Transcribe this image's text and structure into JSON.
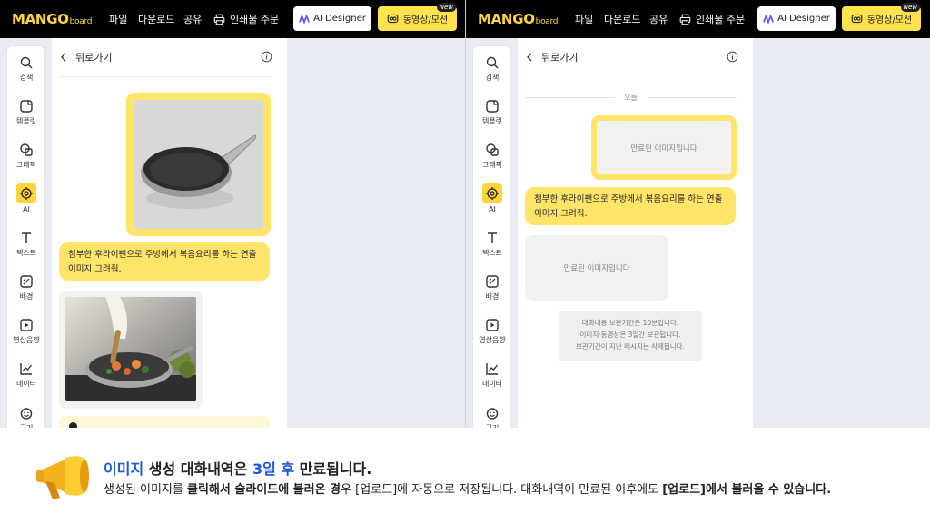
{
  "header": {
    "logo_main": "MANGO",
    "logo_sub": "board",
    "menu": [
      "파일",
      "다운로드",
      "공유",
      "인쇄물 주문"
    ],
    "ai_designer_label": "AI Designer",
    "video_label": "동영상/모션",
    "new_badge": "New"
  },
  "sidebar": {
    "items": [
      {
        "label": "검색",
        "icon": "search-icon"
      },
      {
        "label": "템플릿",
        "icon": "template-icon"
      },
      {
        "label": "그래픽",
        "icon": "graphic-icon"
      },
      {
        "label": "AI",
        "icon": "ai-chip-icon",
        "active": true
      },
      {
        "label": "텍스트",
        "icon": "text-icon"
      },
      {
        "label": "배경",
        "icon": "background-icon"
      },
      {
        "label": "영상음향",
        "icon": "video-audio-icon"
      },
      {
        "label": "데이터",
        "icon": "chart-icon"
      },
      {
        "label": "구기",
        "icon": "emoji-icon"
      }
    ]
  },
  "panel": {
    "back_label": "뒤로가기",
    "prompt_text": "첨부한 후라이팬으로 주방에서 볶음요리를 하는 연출 이미지 그려줘.",
    "date_label": "오늘",
    "expired_text": "만료된 이미지입니다",
    "retention_lines": [
      "대화내용 보관기간은 10분입니다.",
      "이미지·동영상은 3일간 보관됩니다.",
      "보관기간이 지난 메시지는 삭제됩니다."
    ]
  },
  "banner": {
    "line1_hl1": "이미지",
    "line1_mid": " 생성 대화내역은 ",
    "line1_hl2": "3일 후",
    "line1_end": " 만료됩니다.",
    "line2_a": "생성된 이미지를 ",
    "line2_b": "클릭해서 슬라이드에 불러온 경",
    "line2_c": "우 [업로드]에 자동으로 저장됩니다. 대화내역이 만료된 이후에도 ",
    "line2_d": "[업로드]에서 불러올 수 있습니다."
  },
  "colors": {
    "accent_yellow": "#ffe46a",
    "topbar": "#000000",
    "highlight_blue": "#1a56db"
  }
}
